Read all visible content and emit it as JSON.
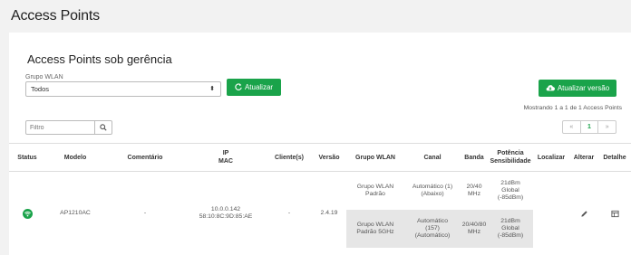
{
  "page": {
    "title": "Access Points"
  },
  "panel": {
    "title": "Access Points sob gerência",
    "group_label": "Grupo WLAN",
    "group_selected": "Todos",
    "refresh_label": "Atualizar",
    "update_version_label": "Atualizar versão",
    "showing_text": "Mostrando 1 a 1 de 1 Access Points",
    "filter_placeholder": "Filtro",
    "pager": {
      "prev": "«",
      "current": "1",
      "next": "»"
    }
  },
  "table": {
    "headers": {
      "status": "Status",
      "model": "Modelo",
      "comment": "Comentário",
      "ip": "IP",
      "mac": "MAC",
      "clients": "Cliente(s)",
      "version": "Versão",
      "group": "Grupo WLAN",
      "channel": "Canal",
      "band": "Banda",
      "power_line1": "Potência",
      "power_line2": "Sensibilidade",
      "locate": "Localizar",
      "edit": "Alterar",
      "detail": "Detalhe"
    },
    "row": {
      "status_icon": "wifi-icon",
      "model": "AP1210AC",
      "comment": "-",
      "ip": "10.0.0.142",
      "mac": "58:10:8C:9D:85:AE",
      "clients": "-",
      "version": "2.4.19",
      "radios": [
        {
          "group_l1": "Grupo WLAN",
          "group_l2": "Padrão",
          "channel_l1": "Automático (1)",
          "channel_l2": "(Abaixo)",
          "channel_l3": "",
          "band_l1": "20/40",
          "band_l2": "MHz",
          "power_l1": "21dBm",
          "power_l2": "Global",
          "power_l3": "(-85dBm)"
        },
        {
          "group_l1": "Grupo WLAN",
          "group_l2": "Padrão 5GHz",
          "channel_l1": "Automático",
          "channel_l2": "(157)",
          "channel_l3": "(Automático)",
          "band_l1": "20/40/80",
          "band_l2": "MHz",
          "power_l1": "21dBm",
          "power_l2": "Global",
          "power_l3": "(-85dBm)"
        }
      ]
    }
  },
  "colors": {
    "accent": "#1aa34a",
    "background": "#f2f2f2",
    "shaded_row": "#e6e6e6"
  }
}
